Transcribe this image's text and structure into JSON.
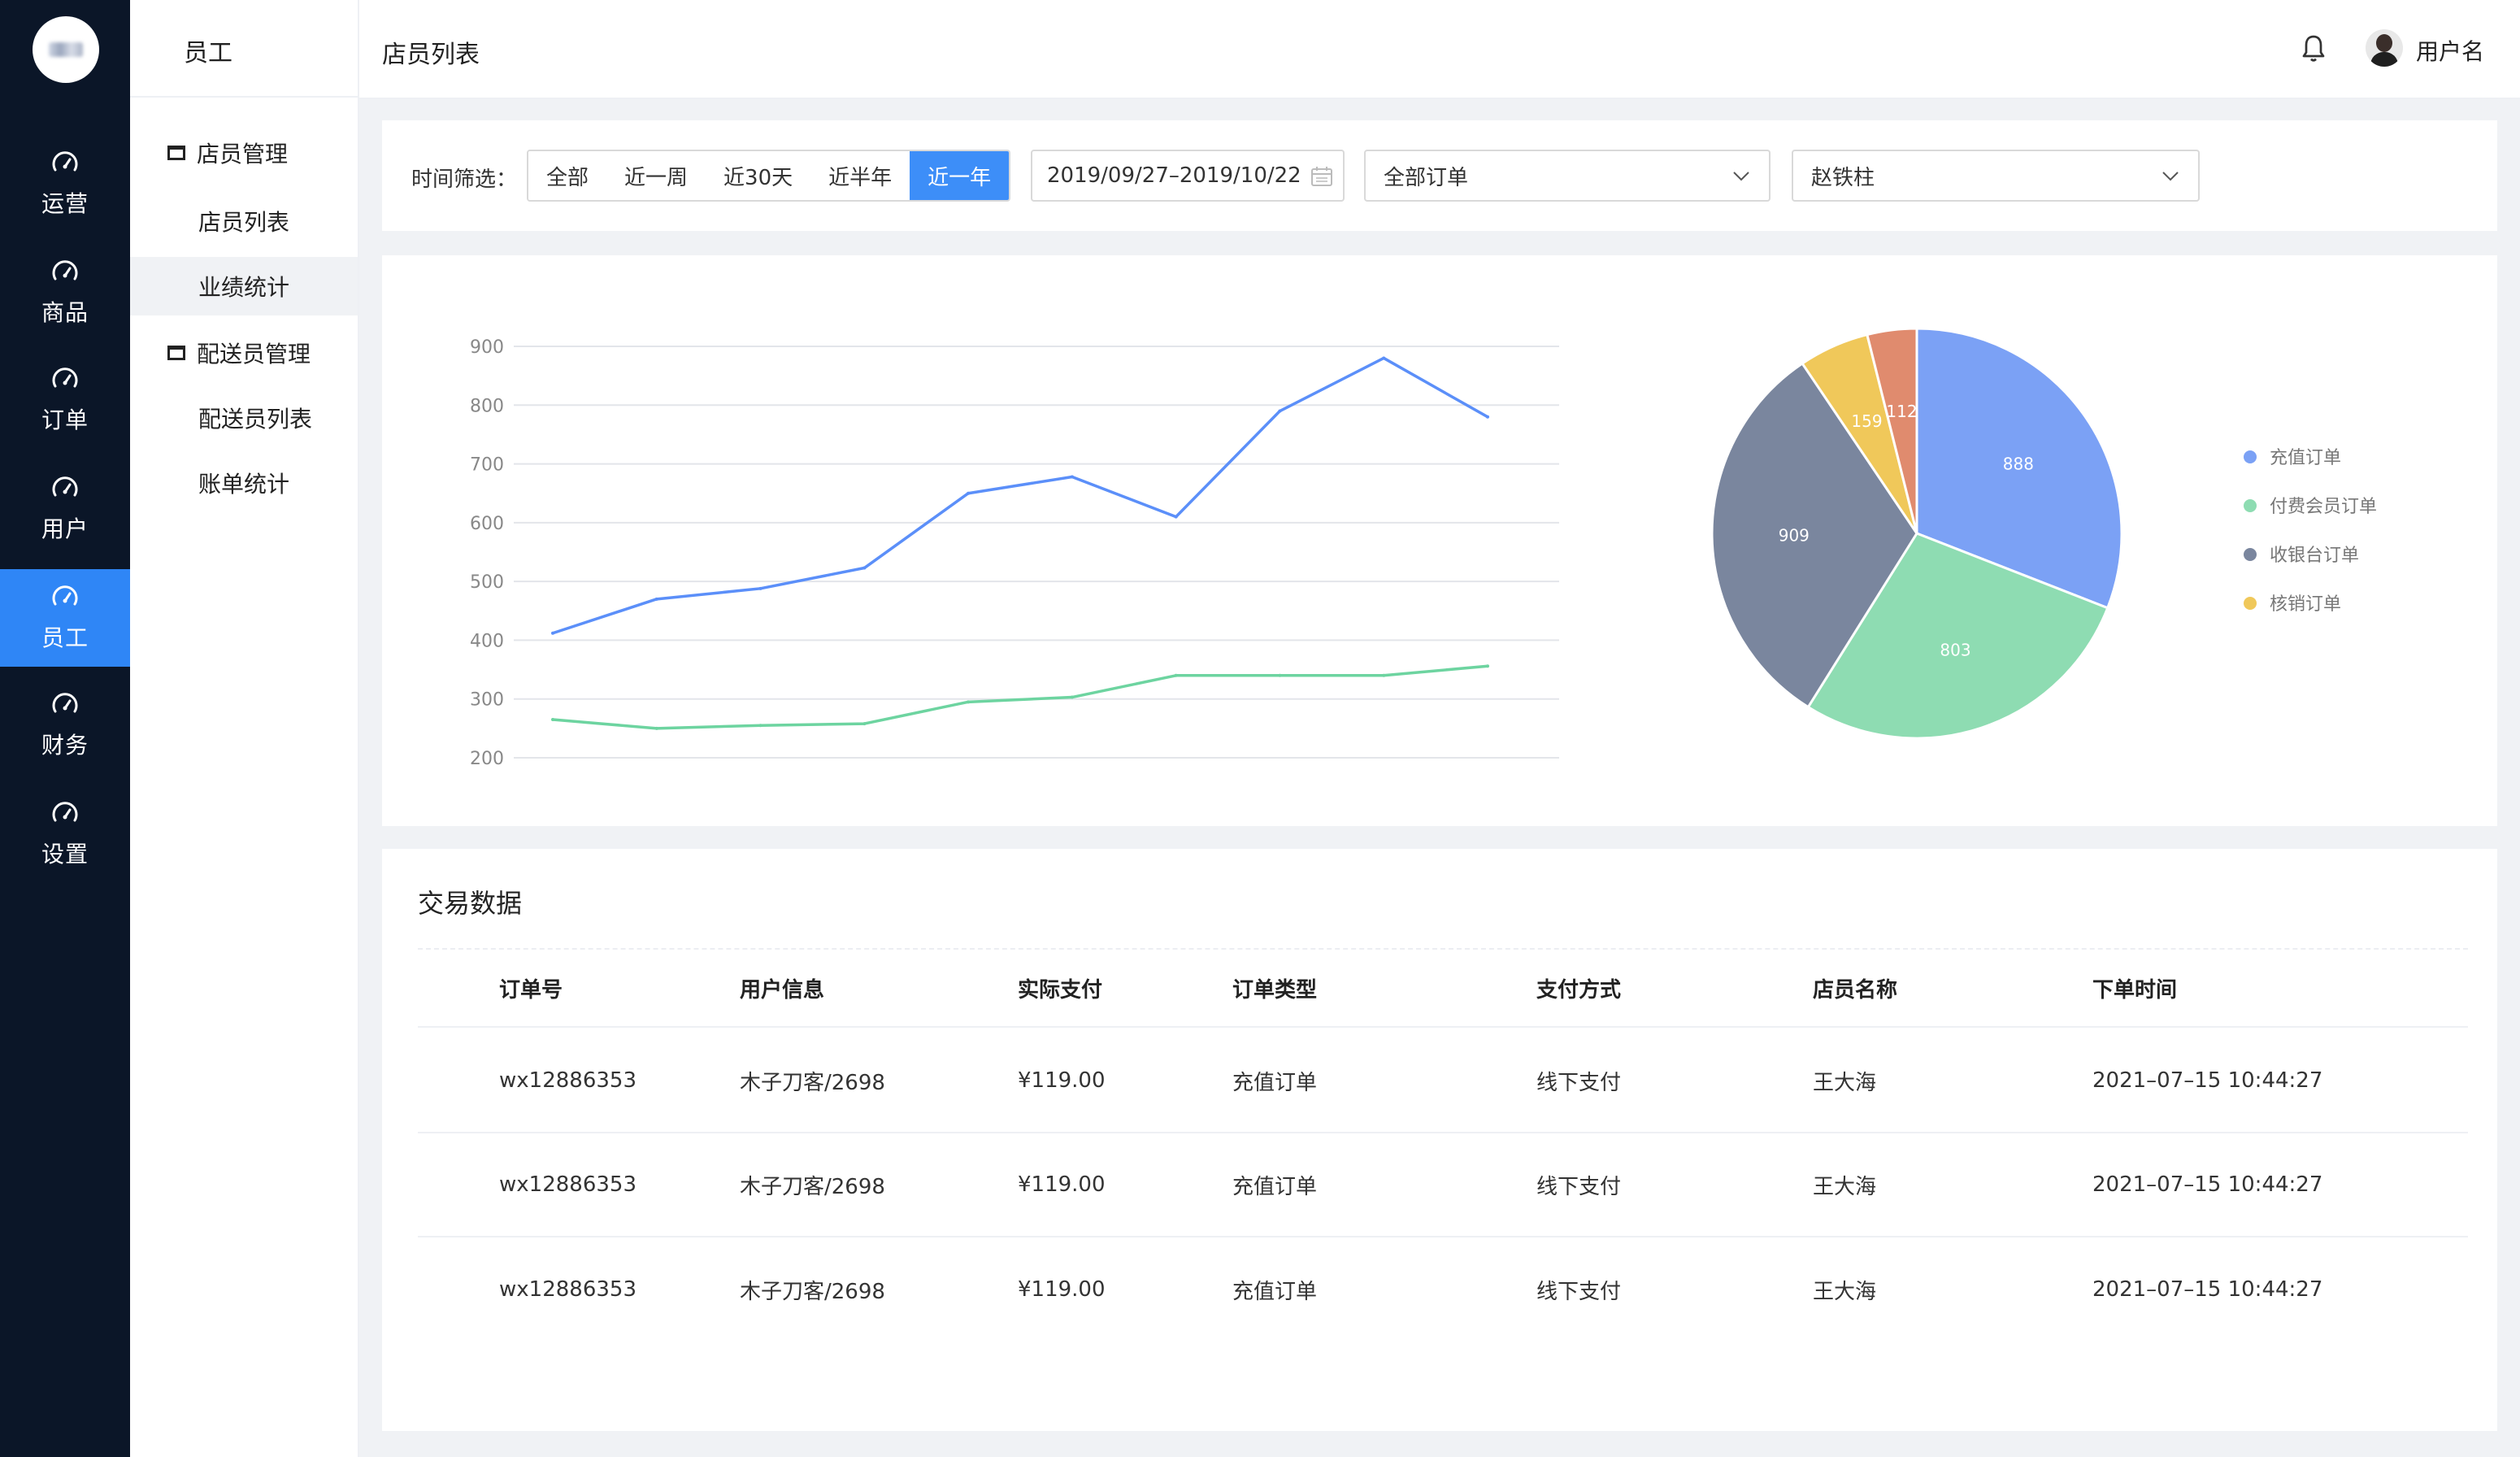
{
  "rail": {
    "items": [
      {
        "label": "运营",
        "icon": "dashboard-icon"
      },
      {
        "label": "商品",
        "icon": "dashboard-icon"
      },
      {
        "label": "订单",
        "icon": "dashboard-icon"
      },
      {
        "label": "用户",
        "icon": "dashboard-icon"
      },
      {
        "label": "员工",
        "icon": "dashboard-icon",
        "active": true
      },
      {
        "label": "财务",
        "icon": "dashboard-icon"
      },
      {
        "label": "设置",
        "icon": "dashboard-icon"
      }
    ]
  },
  "subnav": {
    "title": "员工",
    "groups": [
      {
        "label": "店员管理",
        "items": [
          "店员列表",
          "业绩统计"
        ]
      },
      {
        "label": "配送员管理",
        "items": [
          "配送员列表",
          "账单统计"
        ]
      }
    ],
    "active_item": "业绩统计"
  },
  "header": {
    "breadcrumb": "店员列表",
    "username": "用户名"
  },
  "filter": {
    "label": "时间筛选：",
    "options": [
      "全部",
      "近一周",
      "近30天",
      "近半年",
      "近一年"
    ],
    "selected": "近一年",
    "date_range": "2019/09/27–2019/10/22",
    "order_type": "全部订单",
    "staff": "赵铁柱"
  },
  "chart_data": [
    {
      "type": "line",
      "ylim": [
        200,
        900
      ],
      "yticks": [
        900,
        800,
        700,
        600,
        500,
        400,
        300,
        200
      ],
      "grid": true,
      "series": [
        {
          "values": [
            412,
            470,
            488,
            523,
            650,
            678,
            610,
            790,
            880,
            780
          ],
          "color": "#5b8ff9"
        },
        {
          "values": [
            265,
            250,
            255,
            258,
            295,
            303,
            340,
            340,
            340,
            356
          ],
          "color": "#6dd4a0"
        }
      ]
    },
    {
      "type": "pie",
      "legend_position": "right",
      "slices": [
        {
          "label": "充值订单",
          "value": 888,
          "color": "#7ba1f5"
        },
        {
          "label": "付费会员订单",
          "value": 803,
          "color": "#8edcb2"
        },
        {
          "label": "收银台订单",
          "value": 909,
          "color": "#7a869e"
        },
        {
          "label": "核销订单",
          "value": 159,
          "color": "#f0c85a"
        },
        {
          "label": "",
          "value": 112,
          "color": "#e08b6e"
        }
      ]
    }
  ],
  "table": {
    "title": "交易数据",
    "columns": [
      "订单号",
      "用户信息",
      "实际支付",
      "订单类型",
      "支付方式",
      "店员名称",
      "下单时间"
    ],
    "rows": [
      [
        "wx12886353",
        "木子刀客/2698",
        "¥119.00",
        "充值订单",
        "线下支付",
        "王大海",
        "2021–07–15 10:44:27"
      ],
      [
        "wx12886353",
        "木子刀客/2698",
        "¥119.00",
        "充值订单",
        "线下支付",
        "王大海",
        "2021–07–15 10:44:27"
      ],
      [
        "wx12886353",
        "木子刀客/2698",
        "¥119.00",
        "充值订单",
        "线下支付",
        "王大海",
        "2021–07–15 10:44:27"
      ]
    ]
  }
}
